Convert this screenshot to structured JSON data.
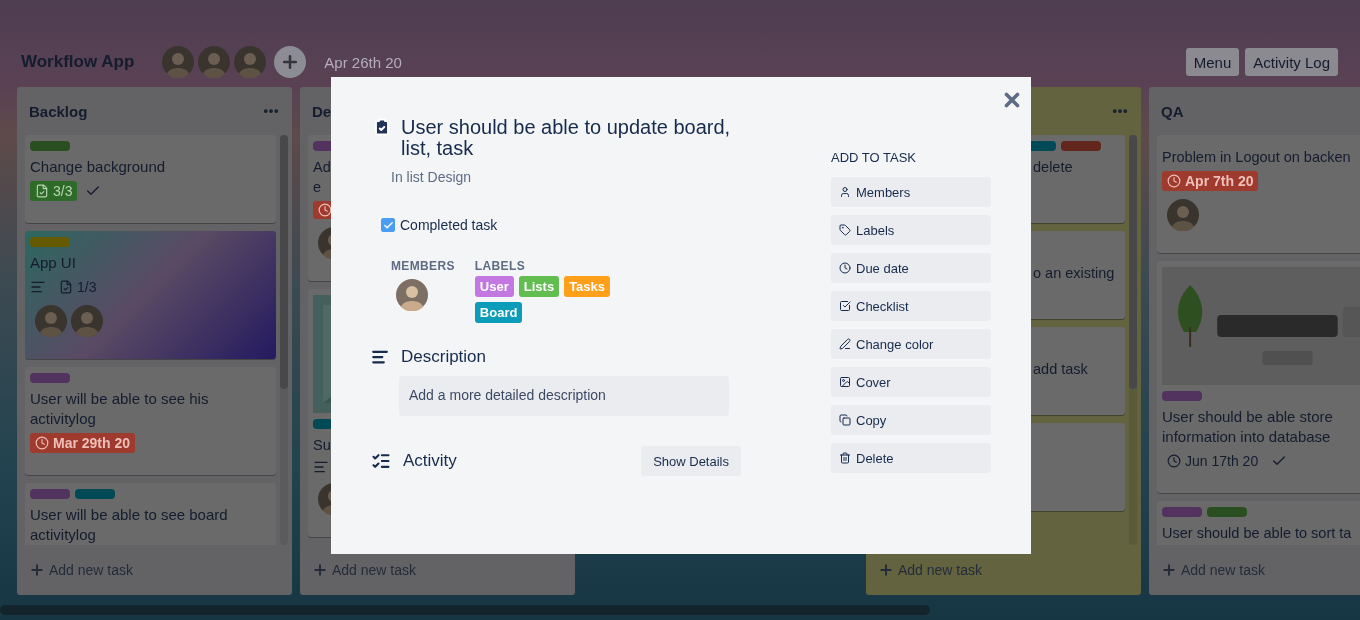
{
  "header": {
    "title": "Workflow App",
    "members": [
      {
        "kind": "avatar"
      },
      {
        "kind": "avatar"
      },
      {
        "kind": "avatar"
      }
    ],
    "date": "Apr 26th 20",
    "buttons": [
      "Menu",
      "Activity Log"
    ]
  },
  "lists": [
    {
      "title": "Backlog",
      "color": "#636365",
      "menu_icon": true,
      "add_label": "Add new task",
      "cards": [
        {
          "kind": "plain",
          "labels": [
            {
              "color": "#294f21"
            }
          ],
          "title": "Change background",
          "badges": [
            {
              "kind": "checklist",
              "text": "3/3",
              "complete": true
            },
            {
              "kind": "done"
            }
          ]
        },
        {
          "kind": "gradient",
          "labels": [
            {
              "color": "#665a00"
            }
          ],
          "title": "App UI",
          "badges": [
            {
              "kind": "description"
            },
            {
              "kind": "checklist",
              "text": "1/3",
              "complete": false
            }
          ],
          "members": [
            {
              "kind": "avatar"
            },
            {
              "kind": "avatar"
            }
          ]
        },
        {
          "kind": "plain",
          "labels": [
            {
              "color": "#52325e"
            }
          ],
          "title": "User will be able to see his activitylog",
          "badges": [
            {
              "kind": "due",
              "text": "Mar 29th 20",
              "overdue": true
            }
          ]
        },
        {
          "kind": "plain",
          "labels": [
            {
              "color": "#52325e"
            },
            {
              "color": "#004956"
            }
          ],
          "title": "User will be able to see board activitylog"
        }
      ]
    },
    {
      "title": "De",
      "color": "#636365",
      "menu_icon": false,
      "add_label": "Add new task",
      "cards": [
        {
          "kind": "plain",
          "labels": [
            {
              "color": "#52325e"
            }
          ],
          "title_lines": [
            "Ad",
            "e"
          ],
          "badges": [
            {
              "kind": "due",
              "overdue": true
            }
          ],
          "members": [
            {
              "kind": "avatar"
            }
          ]
        },
        {
          "kind": "cover",
          "labels": [
            {
              "color": "#004956"
            }
          ],
          "title_lines": [
            "Su"
          ],
          "badges": [
            {
              "kind": "description"
            }
          ],
          "members": [
            {
              "kind": "avatar"
            }
          ]
        }
      ]
    },
    {
      "color": "#63633f",
      "menu_icon": true,
      "add_label": "Add new task",
      "cards": [
        {
          "kind": "plain",
          "labels": [
            {
              "color": "#004956"
            },
            {
              "color": "#63261d"
            }
          ],
          "title_lines": [
            "delete"
          ]
        },
        {
          "kind": "plain",
          "title_lines": [
            "o an existing"
          ]
        },
        {
          "kind": "plain",
          "title_lines": [
            "add task"
          ]
        },
        {
          "kind": "plain"
        }
      ]
    },
    {
      "title": "QA",
      "color": "#636365",
      "menu_icon": false,
      "add_label": "Add new task",
      "cards": [
        {
          "kind": "plain",
          "title_lines": [
            "Problem in Logout on backen"
          ],
          "badges": [
            {
              "kind": "due",
              "text": "Apr 7th 20",
              "overdue": true
            }
          ],
          "members": [
            {
              "kind": "avatar"
            }
          ]
        },
        {
          "kind": "cover",
          "labels": [
            {
              "color": "#52325e"
            }
          ],
          "title": "User should be able store information into database",
          "badges": [
            {
              "kind": "due",
              "text": "Jun 17th 20",
              "overdue": false
            },
            {
              "kind": "done"
            }
          ]
        },
        {
          "kind": "plain",
          "labels": [
            {
              "color": "#52325e"
            },
            {
              "color": "#294f21"
            }
          ],
          "title_lines": [
            "User should be able to sort ta"
          ]
        }
      ]
    }
  ],
  "modal": {
    "title": "User should be able to update board, list, task",
    "list_text": "In list Design",
    "completed": {
      "label": "Completed task",
      "checked": true
    },
    "members_heading": "MEMBERS",
    "members": [
      {
        "kind": "avatar"
      }
    ],
    "labels_heading": "LABELS",
    "labels": [
      {
        "text": "User",
        "color": "#c377e0"
      },
      {
        "text": "Lists",
        "color": "#61bd4f"
      },
      {
        "text": "Tasks",
        "color": "#ff9f1a"
      },
      {
        "text": "Board",
        "color": "#0a9cb8"
      }
    ],
    "description": {
      "heading": "Description",
      "placeholder": "Add a more detailed description"
    },
    "activity": {
      "heading": "Activity",
      "button": "Show Details"
    },
    "sidebar": {
      "heading": "ADD TO TASK",
      "actions": [
        {
          "kind": "members",
          "label": "Members"
        },
        {
          "kind": "labels",
          "label": "Labels"
        },
        {
          "kind": "due",
          "label": "Due date"
        },
        {
          "kind": "checklist",
          "label": "Checklist"
        },
        {
          "kind": "color",
          "label": "Change color"
        },
        {
          "kind": "cover",
          "label": "Cover"
        },
        {
          "kind": "copy",
          "label": "Copy"
        },
        {
          "kind": "delete",
          "label": "Delete"
        }
      ]
    }
  }
}
